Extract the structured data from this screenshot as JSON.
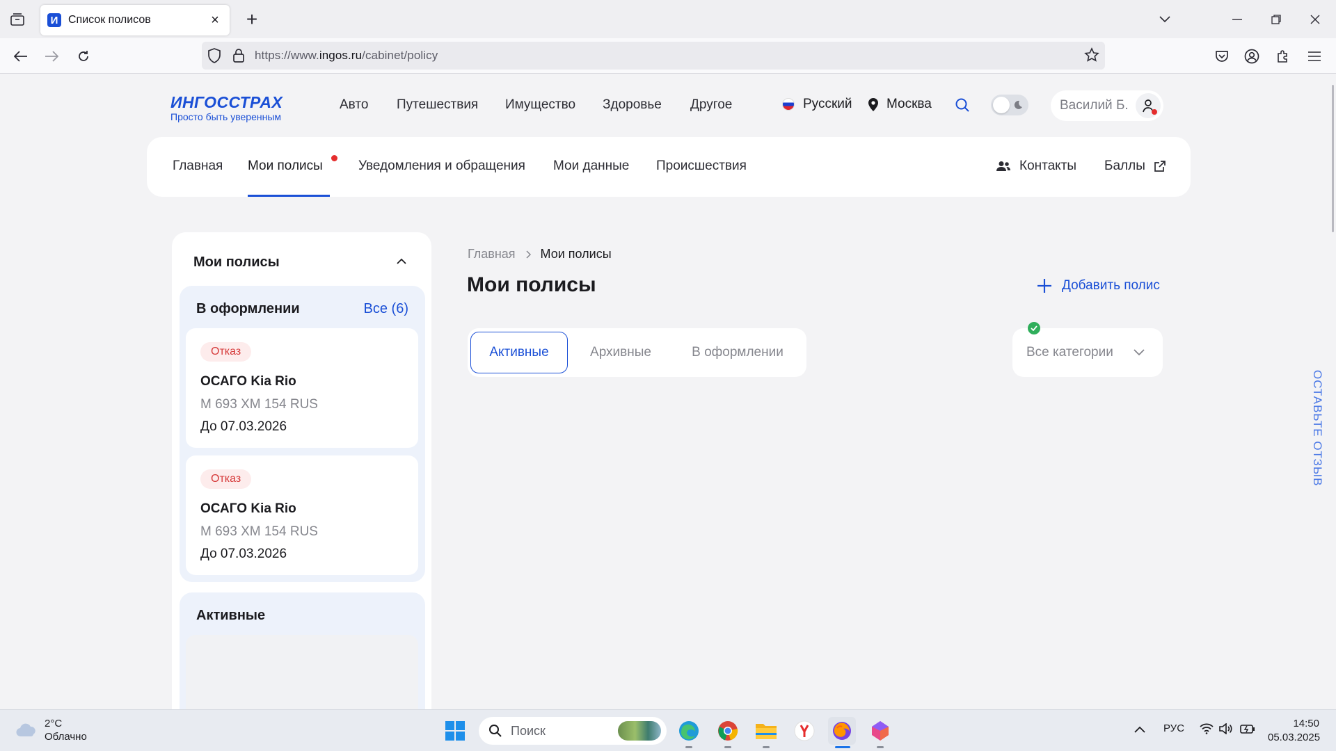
{
  "browser": {
    "tab_title": "Список полисов",
    "tab_favicon_letter": "И",
    "url_prefix": "https://www.",
    "url_domain": "ingos.ru",
    "url_path": "/cabinet/policy"
  },
  "header": {
    "logo_main": "ИНГОССТРАХ",
    "logo_sub": "Просто быть уверенным",
    "menu": [
      "Авто",
      "Путешествия",
      "Имущество",
      "Здоровье",
      "Другое"
    ],
    "language": "Русский",
    "city": "Москва",
    "user_name": "Василий Б."
  },
  "subnav": {
    "items": [
      "Главная",
      "Мои полисы",
      "Уведомления и обращения",
      "Мои данные",
      "Происшествия"
    ],
    "active_index": 1,
    "contacts": "Контакты",
    "points": "Баллы"
  },
  "sidebar": {
    "title": "Мои полисы",
    "group_pending": {
      "title": "В оформлении",
      "all_link": "Все (6)",
      "cards": [
        {
          "status": "Отказ",
          "title": "ОСАГО Kia Rio",
          "plate": "М 693 ХМ 154 RUS",
          "until": "До 07.03.2026"
        },
        {
          "status": "Отказ",
          "title": "ОСАГО Kia Rio",
          "plate": "М 693 ХМ 154 RUS",
          "until": "До 07.03.2026"
        }
      ]
    },
    "group_active": {
      "title": "Активные"
    }
  },
  "main": {
    "breadcrumb_home": "Главная",
    "breadcrumb_current": "Мои полисы",
    "title": "Мои полисы",
    "add_policy": "Добавить полис",
    "filter_tabs": [
      "Активные",
      "Архивные",
      "В оформлении"
    ],
    "active_filter_index": 0,
    "category_select": "Все категории",
    "feedback": "ОСТАВЬТЕ ОТЗЫВ"
  },
  "taskbar": {
    "temperature": "2°C",
    "weather": "Облачно",
    "search_placeholder": "Поиск",
    "language": "РУС",
    "time": "14:50",
    "date": "05.03.2025"
  },
  "colors": {
    "brand_blue": "#1a4fd6",
    "notify_red": "#e52d2d",
    "success_green": "#2fae5b"
  }
}
